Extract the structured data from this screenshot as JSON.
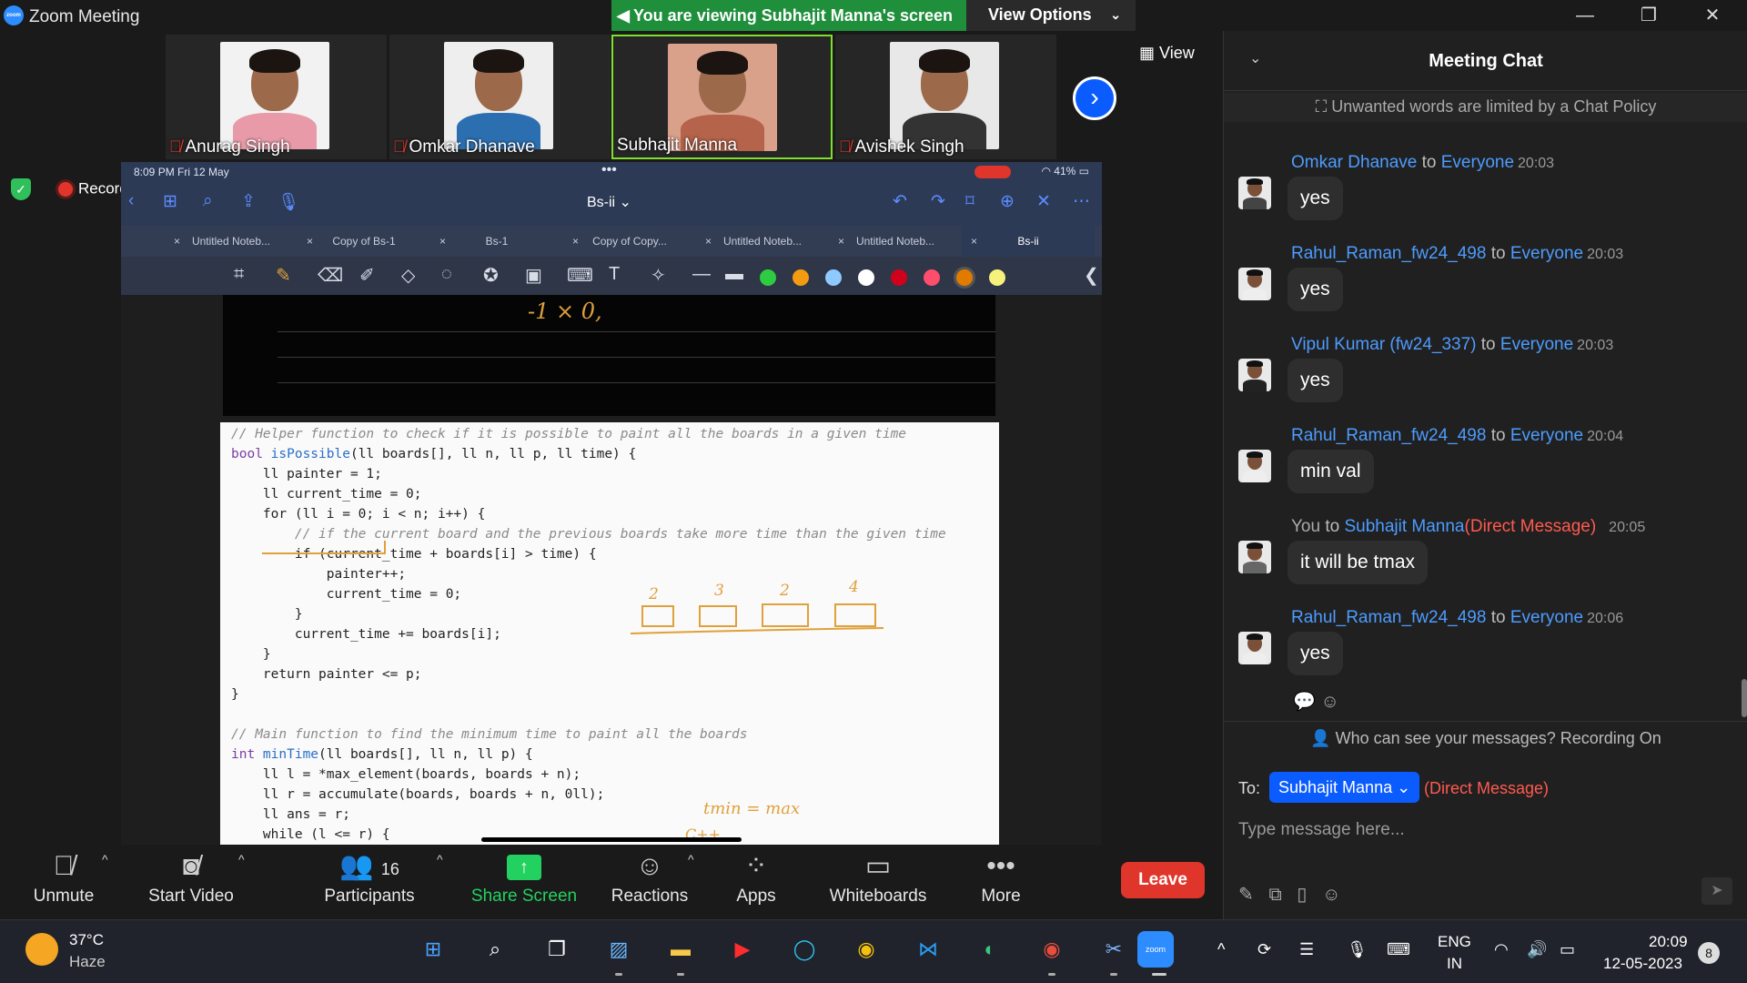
{
  "window": {
    "title": "Zoom Meeting",
    "logo_text": "zoom"
  },
  "banner": {
    "viewing": "You are viewing Subhajit Manna's screen",
    "view_options": "View Options"
  },
  "participants_strip": [
    {
      "name": "Anurag Singh",
      "muted": true,
      "active": false
    },
    {
      "name": "Omkar Dhanave",
      "muted": true,
      "active": false
    },
    {
      "name": "Subhajit Manna",
      "muted": false,
      "active": true
    },
    {
      "name": "Avishek Singh",
      "muted": true,
      "active": false
    }
  ],
  "view_button": "View",
  "recording": {
    "label": "Recording"
  },
  "ipad": {
    "status_left": "8:09 PM   Fri 12 May",
    "status_dots": "•••",
    "battery": "41%",
    "doc_title": "Bs-ii ⌄",
    "tabs": [
      "Untitled Noteb...",
      "Copy of Bs-1",
      "Bs-1",
      "Copy of Copy...",
      "Untitled Noteb...",
      "Untitled Noteb...",
      "Bs-ii"
    ],
    "handwriting_top": "-1 ⨯ 0,"
  },
  "code": {
    "l1": "// Helper function to check if it is possible to paint all the boards in a given time",
    "l2a": "bool ",
    "l2b": "isPossible",
    "l2c": "(ll boards[], ll n, ll p, ll time) {",
    "l3": "    ll painter = 1;",
    "l4": "    ll current_time = 0;",
    "l5": "    for (ll i = 0; i < n; i++) {",
    "l6": "        // if the current board and the previous boards take more time than the given time",
    "l7": "        if (current_time + boards[i] > time) {",
    "l8": "            painter++;",
    "l9": "            current_time = 0;",
    "l10": "        }",
    "l11": "        current_time += boards[i];",
    "l12": "    }",
    "l13": "    return painter <= p;",
    "l14": "}",
    "l15": "",
    "l16": "// Main function to find the minimum time to paint all the boards",
    "l17a": "int ",
    "l17b": "minTime",
    "l17c": "(ll boards[], ll n, ll p) {",
    "l18": "    ll l = *max_element(boards, boards + n);",
    "l19": "    ll r = accumulate(boards, boards + n, 0ll);",
    "l20": "    ll ans = r;",
    "l21": "    while (l <= r) {"
  },
  "annotations": {
    "nums": [
      "2",
      "3",
      "2",
      "4"
    ],
    "tmin": "tmin = max",
    "cpp": "C++"
  },
  "controls": {
    "unmute": "Unmute",
    "start_video": "Start Video",
    "participants": "Participants",
    "participants_count": "16",
    "share_screen": "Share Screen",
    "reactions": "Reactions",
    "apps": "Apps",
    "whiteboards": "Whiteboards",
    "more": "More",
    "leave": "Leave"
  },
  "chat": {
    "title": "Meeting Chat",
    "policy": "Unwanted words are limited by a Chat Policy",
    "messages": [
      {
        "from": "Omkar Dhanave",
        "mid": " to ",
        "to": "Everyone",
        "time": "20:03",
        "text": "yes"
      },
      {
        "from": "Rahul_Raman_fw24_498",
        "mid": " to ",
        "to": "Everyone",
        "time": "20:03",
        "text": "yes"
      },
      {
        "from": "Vipul Kumar (fw24_337)",
        "mid": " to ",
        "to": "Everyone",
        "time": "20:03",
        "text": "yes"
      },
      {
        "from": "Rahul_Raman_fw24_498",
        "mid": " to ",
        "to": "Everyone",
        "time": "20:04",
        "text": "min val"
      },
      {
        "from": "You",
        "mid": " to ",
        "to": "Subhajit Manna",
        "dm": "(Direct Message)",
        "time": "20:05",
        "text": "it will be tmax"
      },
      {
        "from": "Rahul_Raman_fw24_498",
        "mid": " to ",
        "to": "Everyone",
        "time": "20:06",
        "text": "yes"
      }
    ],
    "who_can_see": "Who can see your messages? Recording On",
    "to_label": "To:",
    "to_value": "Subhajit Manna ⌄",
    "to_dm": "(Direct Message)",
    "input_placeholder": "Type message here..."
  },
  "taskbar": {
    "temp": "37°C",
    "weather": "Haze",
    "lang1": "ENG",
    "lang2": "IN",
    "time": "20:09",
    "date": "12-05-2023",
    "notif_count": "8"
  },
  "colors": {
    "accent": "#0b5cff",
    "share_green": "#23d160",
    "leave_red": "#e0352b",
    "banner_green": "#1f8f3c"
  }
}
